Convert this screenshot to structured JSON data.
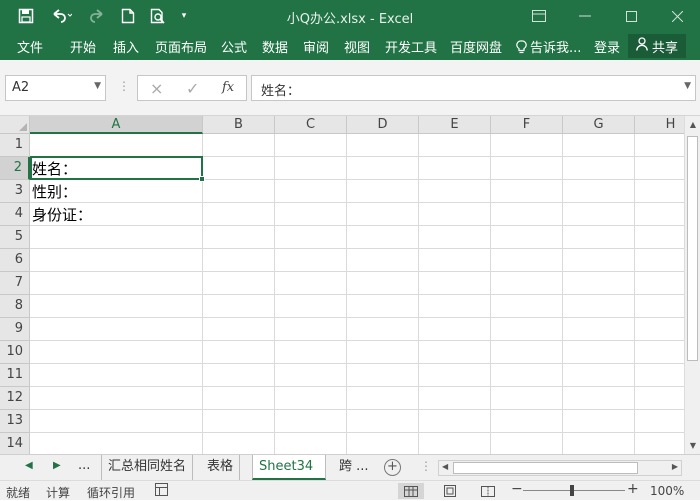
{
  "window": {
    "title": "小Q办公.xlsx - Excel",
    "quick_access": {
      "save_icon": "save-icon",
      "undo_icon": "undo-icon",
      "redo_icon": "redo-icon",
      "new_icon": "new-file-icon",
      "preview_icon": "print-preview-icon",
      "customize_icon": "customize-qat-icon"
    }
  },
  "ribbon": {
    "tabs": [
      "文件",
      "开始",
      "插入",
      "页面布局",
      "公式",
      "数据",
      "审阅",
      "视图",
      "开发工具",
      "百度网盘"
    ],
    "tell_me": "告诉我...",
    "login": "登录",
    "share": "共享"
  },
  "formula_bar": {
    "name_box": "A2",
    "cancel_icon": "×",
    "enter_icon": "✓",
    "fx_label": "fx",
    "content": "姓名："
  },
  "grid": {
    "columns": [
      "A",
      "B",
      "C",
      "D",
      "E",
      "F",
      "G",
      "H"
    ],
    "selected_column": "A",
    "rows": [
      "1",
      "2",
      "3",
      "4",
      "5",
      "6",
      "7",
      "8",
      "9",
      "10",
      "11",
      "12",
      "13",
      "14"
    ],
    "selected_row": "2",
    "cells": {
      "A2": "姓名：",
      "A3": "性别：",
      "A4": "身份证："
    }
  },
  "sheets": {
    "nav_prev": "◀",
    "nav_next": "▶",
    "ellipsis_left": "...",
    "tabs": [
      "汇总相同姓名",
      "表格",
      "Sheet34",
      "跨 ..."
    ],
    "active": "Sheet34",
    "add_label": "+"
  },
  "status": {
    "items": [
      "就绪",
      "计算",
      "循环引用"
    ],
    "zoom_minus": "−",
    "zoom_plus": "+",
    "zoom": "100%",
    "zoom_level_percent": 100
  }
}
